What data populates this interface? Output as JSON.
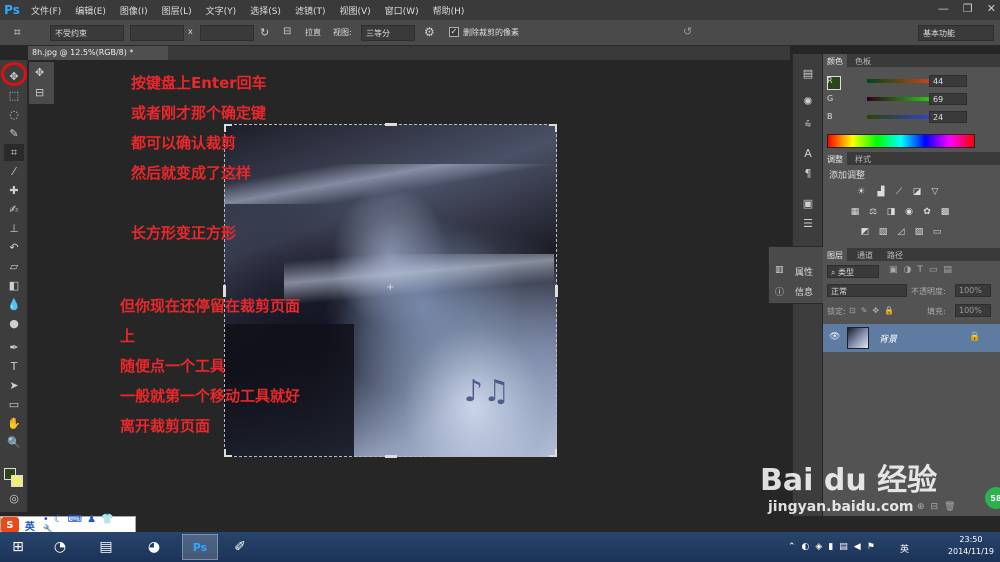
{
  "app": {
    "logo": "Ps"
  },
  "menu": [
    "文件(F)",
    "编辑(E)",
    "图像(I)",
    "图层(L)",
    "文字(Y)",
    "选择(S)",
    "滤镜(T)",
    "视图(V)",
    "窗口(W)",
    "帮助(H)"
  ],
  "window_controls": {
    "minimize": "—",
    "restore": "❐",
    "close": "✕"
  },
  "options_bar": {
    "ratio_select": "不受约束",
    "x_label": "x",
    "straighten": "拉直",
    "view_label": "视图:",
    "view_select": "三等分",
    "delete_cropped": "删除裁剪的像素",
    "workspace": "基本功能"
  },
  "document_tab": "8h.jpg @ 12.5%(RGB/8) *",
  "annotations": {
    "line1": "按键盘上Enter回车",
    "line2": "或者刚才那个确定键",
    "line3": "都可以确认裁剪",
    "line4": "然后就变成了这样",
    "line5": "长方形变正方形",
    "line6": "但你现在还停留在裁剪页面",
    "line7": "上",
    "line8": "随便点一个工具",
    "line9": "一般就第一个移动工具就好",
    "line10": "离开裁剪页面"
  },
  "popout": {
    "properties": "属性",
    "info": "信息"
  },
  "color_panel": {
    "tabs": [
      "颜色",
      "色板"
    ],
    "channels": [
      {
        "label": "R",
        "value": "44"
      },
      {
        "label": "G",
        "value": "69"
      },
      {
        "label": "B",
        "value": "24"
      }
    ]
  },
  "adjust_panel": {
    "tabs": [
      "调整",
      "样式"
    ],
    "title": "添加调整"
  },
  "layers_panel": {
    "tabs": [
      "图层",
      "通道",
      "路径"
    ],
    "kind_select": "类型",
    "blend_mode": "正常",
    "opacity_label": "不透明度:",
    "opacity_value": "100%",
    "lock_label": "锁定:",
    "fill_label": "填充:",
    "fill_value": "100%",
    "layer_name": "背景"
  },
  "watermark": {
    "logo": "Bai du 经验",
    "url": "jingyan.baidu.com"
  },
  "ime": {
    "mode": "英"
  },
  "taskbar": {
    "clock_time": "23:50",
    "clock_date": "2014/11/19",
    "tray_text": "英"
  },
  "green_badge": "58"
}
